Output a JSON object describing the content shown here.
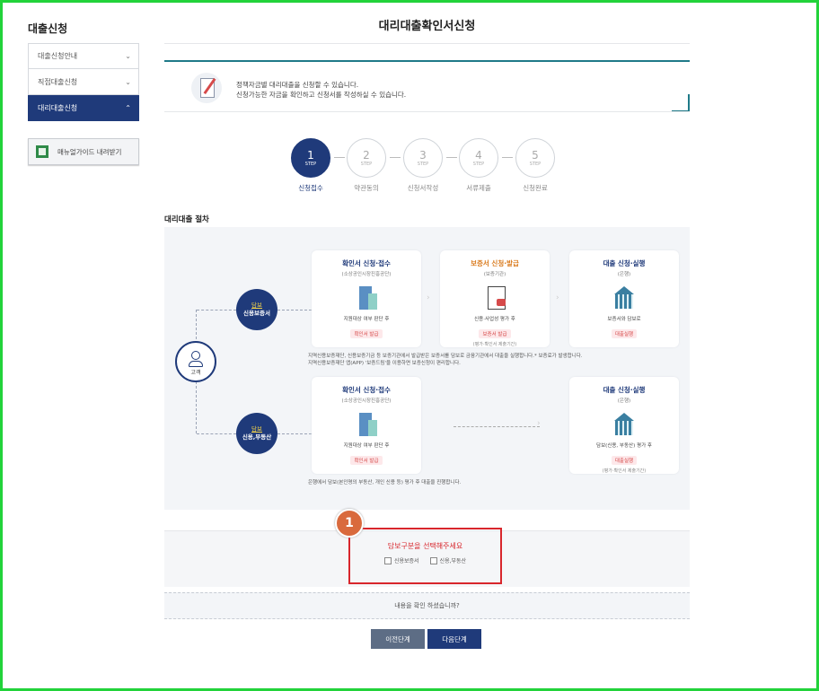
{
  "sidebar": {
    "title": "대출신청",
    "items": [
      {
        "label": "대출신청안내",
        "chevron": "chevron-down-icon"
      },
      {
        "label": "직접대출신청",
        "chevron": "chevron-down-icon"
      },
      {
        "label": "대리대출신청",
        "chevron": "chevron-up-icon",
        "active": true
      }
    ],
    "manual_button": "매뉴얼가이드 내려받기"
  },
  "page": {
    "title": "대리대출확인서신청",
    "notice": [
      "정책자금별 대리대출을 신청할 수 있습니다.",
      "신청가능한 자금을 확인하고 신청서를 작성하실 수 있습니다."
    ]
  },
  "steps": [
    {
      "num": "1",
      "st": "STEP",
      "label": "신청접수",
      "active": true
    },
    {
      "num": "2",
      "st": "STEP",
      "label": "약관동의"
    },
    {
      "num": "3",
      "st": "STEP",
      "label": "신청서작성"
    },
    {
      "num": "4",
      "st": "STEP",
      "label": "서류제출"
    },
    {
      "num": "5",
      "st": "STEP",
      "label": "신청완료"
    }
  ],
  "procedure": {
    "title": "대리대출 절차",
    "customer": "고객",
    "type1": {
      "top": "담보",
      "bottom": "신용보증서"
    },
    "type2": {
      "top": "담보",
      "bottom": "신용,부동산"
    },
    "row1": [
      {
        "head": "확인서 신청·접수",
        "sub": "(소상공인시장진흥공단)",
        "desc": "지원대상 여부 판단 후",
        "red": "확인서 발급"
      },
      {
        "head": "보증서 신청·발급",
        "sub": "(보증기관)",
        "desc": "신용·사업성 평가 후",
        "red": "보증서 발급",
        "note": "(평가·확인서 제출기간)"
      },
      {
        "head": "대출 신청·실행",
        "sub": "(은행)",
        "desc": "보증서와 담보로",
        "red": "대출실행"
      }
    ],
    "row1_note": [
      "지역신용보증재단, 신용보증기금 등 보증기관에서 발급받은 보증서를 담보로 금융기관에서 대출을 실행합니다.* 보증료가 발생합니다.",
      "지역신용보증재단 앱(APP) '보증드림'을 이용하면 보증신청이 편리합니다."
    ],
    "row2": [
      {
        "head": "확인서 신청·접수",
        "sub": "(소상공인시장진흥공단)",
        "desc": "지원대상 여부 판단 후",
        "red": "확인서 발급"
      },
      {
        "head": "대출 신청·실행",
        "sub": "(은행)",
        "desc": "담보(신용, 부동산) 평가 후",
        "red": "대출실행",
        "note": "(평가·확인서 제출기간)"
      }
    ],
    "row2_note": "은행에서 담보(본인명의 부동산, 개인 신용 등) 평가 후 대출을 진행합니다."
  },
  "selection": {
    "badge": "1",
    "question": "담보구분을 선택해주세요",
    "options": [
      "신용보증서",
      "신용,부동산"
    ]
  },
  "confirm_text": "내용을 확인 하셨습니까?",
  "buttons": {
    "prev": "이전단계",
    "next": "다음단계"
  }
}
